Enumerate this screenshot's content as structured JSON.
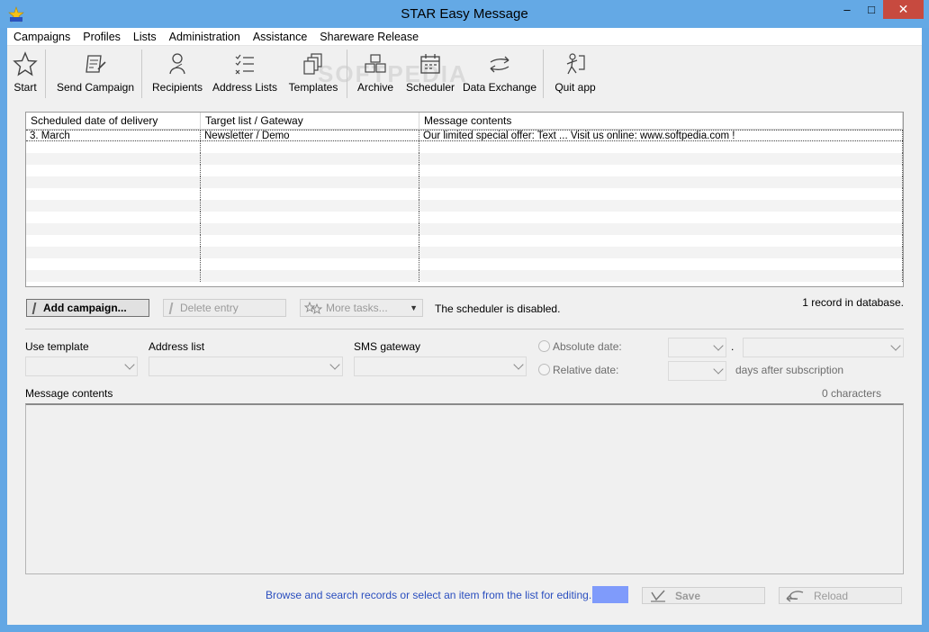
{
  "window": {
    "title": "STAR Easy Message",
    "minimize": "–",
    "maximize": "□",
    "close": "✕"
  },
  "menu": [
    "Campaigns",
    "Profiles",
    "Lists",
    "Administration",
    "Assistance",
    "Shareware Release"
  ],
  "toolbar": {
    "start": "Start",
    "send_campaign": "Send Campaign",
    "recipients": "Recipients",
    "address_lists": "Address Lists",
    "templates": "Templates",
    "archive": "Archive",
    "scheduler": "Scheduler",
    "data_exchange": "Data Exchange",
    "quit_app": "Quit app",
    "watermark": "SOFTPEDIA"
  },
  "grid": {
    "columns": [
      "Scheduled date of delivery",
      "Target list / Gateway",
      "Message contents"
    ],
    "rows": [
      [
        "3. March",
        "Newsletter / Demo",
        "Our limited special offer: Text ... Visit us online: www.softpedia.com !"
      ]
    ]
  },
  "actions": {
    "add_campaign": "Add campaign...",
    "delete_entry": "Delete entry",
    "more_tasks": "More tasks...",
    "scheduler_status": "The scheduler is disabled.",
    "record_count": "1 record in database."
  },
  "form": {
    "use_template": "Use template",
    "address_list": "Address list",
    "sms_gateway": "SMS gateway",
    "absolute_date": "Absolute date:",
    "relative_date": "Relative date:",
    "date_separator": ".",
    "days_after": "days after subscription",
    "message_contents": "Message contents",
    "char_count": "0 characters"
  },
  "footer": {
    "hint": "Browse and search records or select an item from the list for editing.",
    "save": "Save",
    "reload": "Reload"
  },
  "colors": {
    "titlebar": "#64a9e5",
    "close": "#c74a3f",
    "hint": "#2b4fbf",
    "swatch": "#7f9bfb"
  }
}
